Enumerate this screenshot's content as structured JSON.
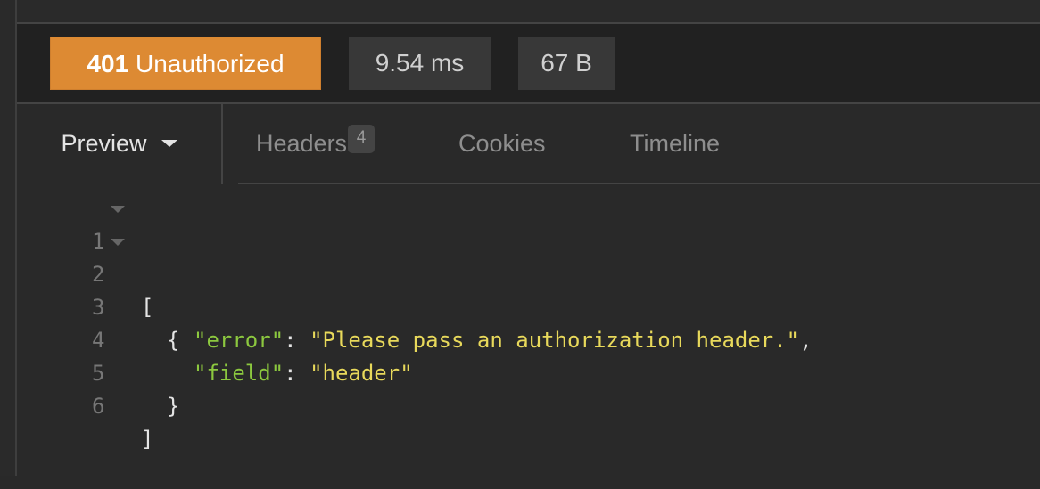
{
  "status": {
    "code": "401",
    "text": "Unauthorized",
    "color": "#dd8a33",
    "time": "9.54 ms",
    "size": "67 B"
  },
  "tabs": {
    "preview": "Preview",
    "headers": "Headers",
    "headers_count": "4",
    "cookies": "Cookies",
    "timeline": "Timeline",
    "active": "Preview"
  },
  "response": {
    "lines": [
      {
        "num": "1",
        "foldable": true
      },
      {
        "num": "2",
        "foldable": true
      },
      {
        "num": "3",
        "key": "\"error\"",
        "value": "\"Please pass an authorization header.\""
      },
      {
        "num": "4",
        "key": "\"field\"",
        "value": "\"header\""
      },
      {
        "num": "5"
      },
      {
        "num": "6"
      }
    ],
    "open_bracket": "[",
    "open_brace": "{",
    "close_brace": "}",
    "close_bracket": "]",
    "colon": ": ",
    "comma": ","
  }
}
